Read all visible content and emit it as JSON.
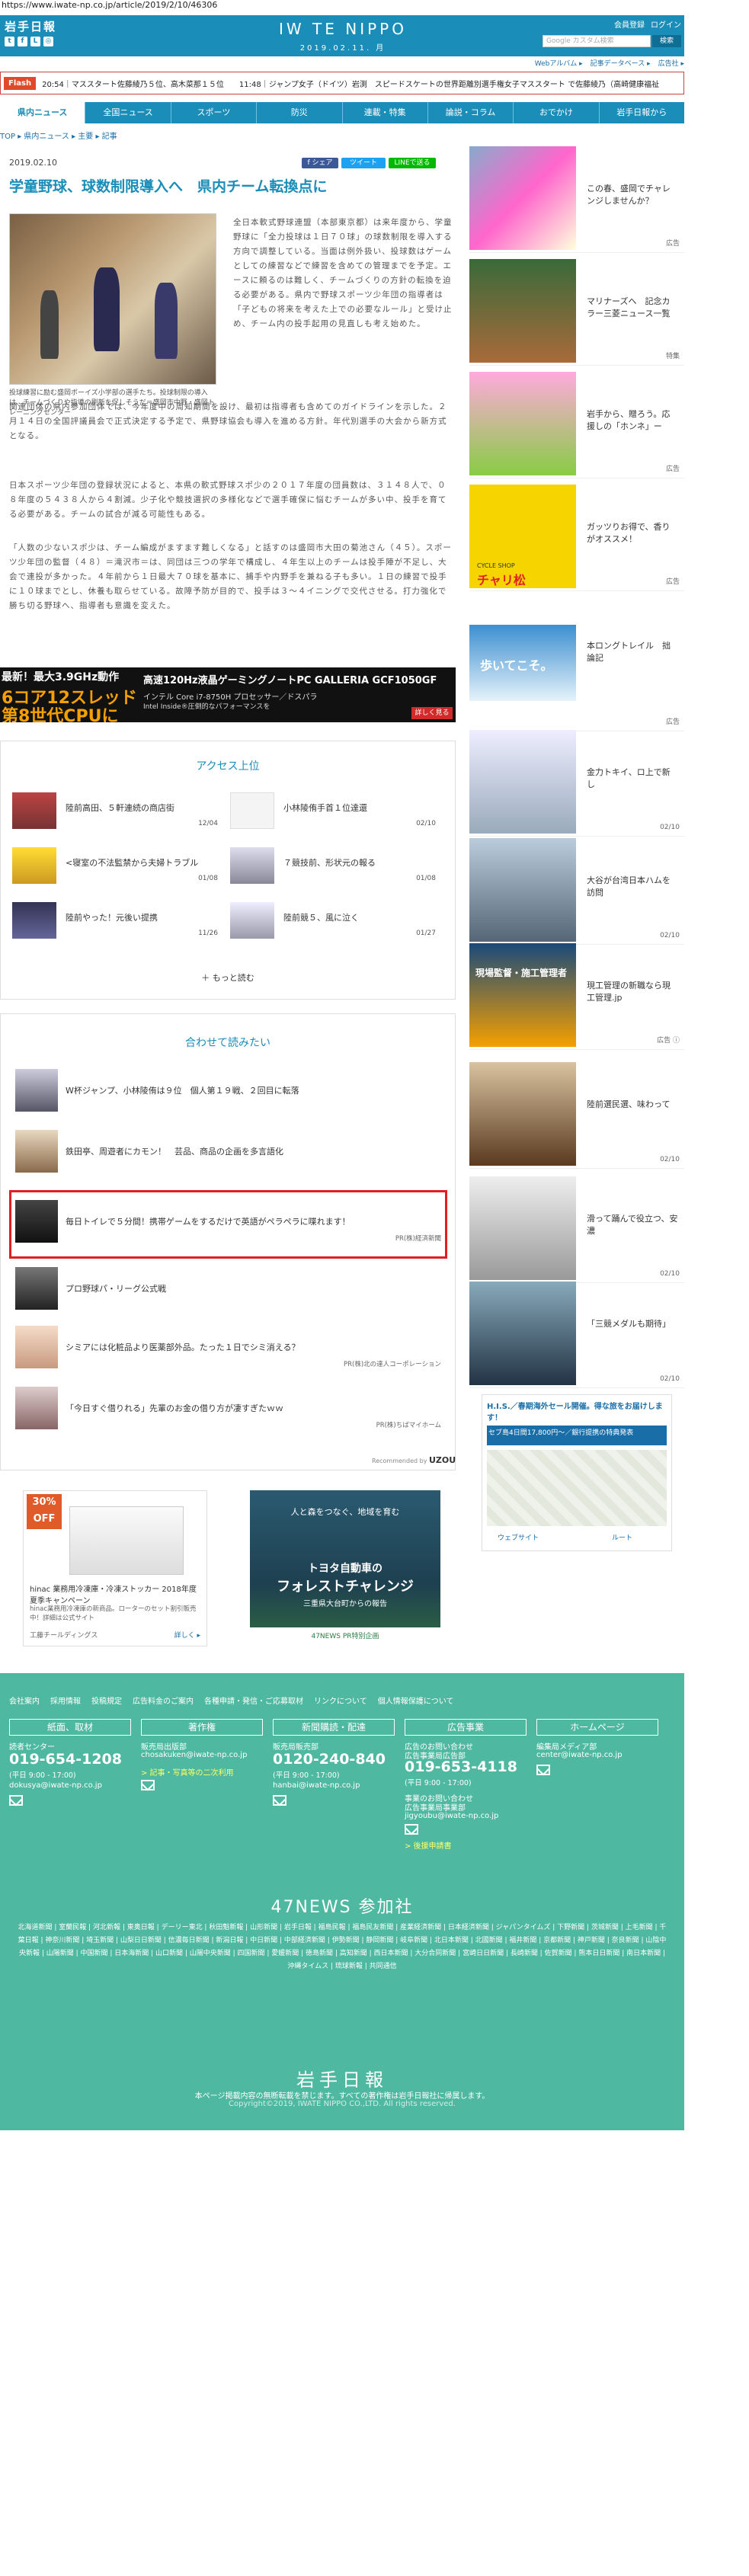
{
  "url": "https://www.iwate-np.co.jp/article/2019/2/10/46306",
  "header": {
    "logo_left": "岩手日報",
    "center_logo": "IW TE NIPPO",
    "center_date": "2019.02.11. 月",
    "login": [
      "会員登録",
      "ログイン"
    ],
    "search_placeholder": "Google カスタム検索",
    "search_button": "検索",
    "sublinks": [
      "Webアルバム ▸",
      "記事データベース ▸",
      "広告社 ▸"
    ]
  },
  "flash": {
    "label": "Flash",
    "text": "20:54｜マススタート佐藤綾乃５位、高木菜那１５位　　11:48｜ジャンプ女子（ドイツ）岩渕　スピードスケートの世界距離別選手権女子マススタート で佐藤綾乃（高崎健康福祉"
  },
  "nav": [
    "県内ニュース",
    "全国ニュース",
    "スポーツ",
    "防災",
    "連載・特集",
    "論説・コラム",
    "おでかけ",
    "岩手日報から"
  ],
  "breadcrumb": "TOP ▸ 県内ニュース ▸ 主要 ▸ 記事",
  "article": {
    "date": "2019.02.10",
    "share": [
      "f シェア",
      "ツイート",
      "LINEで送る"
    ],
    "title": "学童野球、球数制限導入へ　県内チーム転換点に",
    "caption": "投球練習に励む盛岡ボーイズ小学部の選手たち。投球制限の導入は、チームづくりや指導の刷新を促しそうだ＝盛岡市中野・盛岡トレーニングセンター",
    "lead": "全日本軟式野球連盟（本部東京都）は来年度から、学童野球に「全力投球は１日７０球」の球数制限を導入する方向で調整している。当面は例外扱い、投球数はゲームとしての練習などで練習を含めての管理までを予定。エースに頼るのは難しく、チームづくりの方針の転換を迫る必要がある。県内で野球スポーツ少年団の指導者は「子どもの将来を考えた上での必要なルール」と受け止め、チーム内の投手起用の見直しも考え始めた。",
    "p1": "関連団体の県内参加団体では、今年度中の周知期間を設け、最初は指導者も含めてのガイドラインを示した。２月１４日の全国評議員会で正式決定する予定で、県野球協会も導入を進める方針。年代別選手の大会から新方式となる。",
    "p2": "日本スポーツ少年団の登録状況によると、本県の軟式野球スポ少の２０１７年度の団員数は、３１４８人で、０８年度の５４３８人から４割減。少子化や競技選択の多様化などで選手確保に悩むチームが多い中、投手を育てる必要がある。チームの試合が減る可能性もある。",
    "p3": "「人数の少ないスポ少は、チーム編成がますます難しくなる」と話すのは盛岡市大田の菊池さん（４５）。スポーツ少年団の監督（４８）＝滝沢市＝は、同団は三つの学年で構成し、４年生以上のチームは投手陣が不足し、大会で連投が多かった。４年前から１日最大７０球を基本に、捕手や内野手を兼ねる子も多い。１日の練習で投手に１０球までとし、休養も取らせている。故障予防が目的で、投手は３～４イニングで交代させる。打力強化で勝ち切る野球へ、指導者も意識を変えた。"
  },
  "pc_banner": {
    "l1": "最新！最大3.9GHz動作",
    "l2": "6コア12スレッド",
    "l3": "第8世代CPUに",
    "t1": "高速120Hz液晶ゲーミングノートPC GALLERIA GCF1050GF",
    "t2": "インテル Core i7-8750H プロセッサー／ドスパラ",
    "t3": "Intel Inside®圧倒的なパフォーマンスを",
    "btn": "詳しく見る"
  },
  "access": {
    "title": "アクセス上位",
    "items": [
      {
        "text": "陸前高田、５軒連続の商店街",
        "date": "12/04"
      },
      {
        "text": "小林陵侑手首１位達還",
        "date": "02/10"
      },
      {
        "text": "<寝室の不法監禁から夫婦トラブル",
        "date": "01/08"
      },
      {
        "text": "７競技前、形状元の報る",
        "date": "01/08"
      },
      {
        "text": "陸前やった！元後い提携",
        "date": "11/26"
      },
      {
        "text": "陸前競５、風に泣く",
        "date": "01/27"
      }
    ],
    "more": "＋ もっと読む"
  },
  "related": {
    "title": "合わせて読みたい",
    "items": [
      {
        "text": "W杯ジャンプ、小林陵侑は９位　個人第１９戦、２回目に転落",
        "pr": ""
      },
      {
        "text": "鉄田亭、周遊者にカモン！　芸品、商品の企画を多言語化",
        "pr": ""
      },
      {
        "text": "毎日トイレで５分間！携帯ゲームをするだけで英語がペラペラに喋れます！",
        "pr": "PR(株)経済新聞"
      },
      {
        "text": "プロ野球パ・リーグ公式戦",
        "pr": ""
      },
      {
        "text": "シミアには化粧品より医薬部外品。たった１日でシミ消える？",
        "pr": "PR(株)北の達人コーポレーション"
      },
      {
        "text": "「今日すぐ借りれる」先輩のお金の借り方が凄すぎたｗｗ",
        "pr": "PR(株)ちばマイホーム"
      }
    ],
    "credit": "Recommended by ",
    "credit_brand": "UZOU"
  },
  "ad1": {
    "badge": "30% OFF",
    "title": "hinac 業務用冷凍庫・冷凍ストッカー 2018年度夏季キャンペーン",
    "text": "hinac業務用冷凍庫の新商品。ローターのセット割引販売中！詳細は公式サイト",
    "brand": "工藤チールディングス",
    "more": "詳しく ▸"
  },
  "ad2": {
    "l1": "人と森をつなぐ、地域を育む",
    "l2": "トヨタ自動車の",
    "l3": "フォレストチャレンジ",
    "l4": "三重県大台町からの報告",
    "tag": "47NEWS PR特別企画"
  },
  "sidebar": [
    {
      "text": "この春、盛岡でチャレンジしませんか？",
      "foot": "広告"
    },
    {
      "text": "マリナーズへ　記念カラー三菱ニュース一覧",
      "foot": "特集"
    },
    {
      "text": "岩手から、贈ろう。応援しの「ホンネ」ー",
      "foot": "広告"
    },
    {
      "text": "ガッツりお得で、香りがオススメ！",
      "foot": "広告"
    },
    {
      "text": "本ロングトレイル　拙論記",
      "foot": "広告"
    },
    {
      "text": "金力トキイ、ロ上で新し",
      "foot": "02/10"
    },
    {
      "text": "大谷が台湾日本ハムを訪問",
      "foot": "02/10"
    },
    {
      "text": "現工管理の新職なら現工管理.jp",
      "foot": "広告 ⓘ"
    },
    {
      "text": "陸前選民選、味わって",
      "foot": "02/10"
    },
    {
      "text": "滑って踊んで役立つ、安濃",
      "foot": "02/10"
    },
    {
      "text": "「三競メダルも期待」",
      "foot": "02/10"
    }
  ],
  "side_ad_text": {
    "mascot": "チャリ松",
    "cycle": "CYCLE SHOP",
    "kansai": "現場監督・施工管理者",
    "trail": "歩いてこそ。"
  },
  "map_ad": {
    "title": "H.I.S.／春期海外セール開催。得な旅をお届けします！",
    "desc": "セブ島4日間17,800円〜／銀行提携の特典発表",
    "route": "ルート",
    "website": "ウェブサイト"
  },
  "footer": {
    "links": [
      "会社案内",
      "採用情報",
      "投稿規定",
      "広告料金のご案内",
      "各種申請・発信・ご応募取材",
      "リンクについて",
      "個人情報保護について"
    ],
    "cols": [
      {
        "title": "紙面、取材",
        "sub": "読者センター",
        "phone": "019-654-1208",
        "time": "(平日 9:00 - 17:00)",
        "email": "dokusya@iwate-np.co.jp"
      },
      {
        "title": "著作権",
        "sub": "販売局出版部",
        "phone": "",
        "time": "",
        "email": "chosakuken@iwate-np.co.jp",
        "extra": "> 記事・写真等の二次利用"
      },
      {
        "title": "新聞購読・配達",
        "sub": "販売局販売部",
        "phone": "0120-240-840",
        "time": "(平日 9:00 - 17:00)",
        "email": "hanbai@iwate-np.co.jp"
      },
      {
        "title": "広告事業",
        "sub": "広告のお問い合わせ",
        "sub2": "広告事業局広告部",
        "phone": "019-653-4118",
        "time": "(平日 9:00 - 17:00)",
        "email": "jigyoubu@iwate-np.co.jp",
        "extra": "> 後援申請書"
      },
      {
        "title": "ホームページ",
        "sub": "編集局メディア部",
        "phone": "",
        "time": "",
        "email": "center@iwate-np.co.jp"
      }
    ],
    "sub_event": "事業のお問い合わせ",
    "sub_event2": "広告事業局事業部",
    "news47_title": "47NEWS 参加社",
    "news47": "北海道新聞 | 室蘭民報 | 河北新報 | 東奥日報 | デーリー東北 | 秋田魁新報 | 山形新聞 | 岩手日報 | 福島民報 | 福島民友新聞 | 産業経済新聞 | 日本経済新聞 | ジャパンタイムズ | 下野新聞 | 茨城新聞 | 上毛新聞 | 千葉日報 | 神奈川新聞 | 埼玉新聞 | 山梨日日新聞 | 信濃毎日新聞 | 新潟日報 | 中日新聞 | 中部経済新聞 | 伊勢新聞 | 静岡新聞 | 岐阜新聞 | 北日本新聞 | 北國新聞 | 福井新聞 | 京都新聞 | 神戸新聞 | 奈良新聞 | 山陰中央新報 | 山陽新聞 | 中国新聞 | 日本海新聞 | 山口新聞 | 山陽中央新聞 | 四国新聞 | 愛媛新聞 | 徳島新聞 | 高知新聞 | 西日本新聞 | 大分合同新聞 | 宮崎日日新聞 | 長崎新聞 | 佐賀新聞 | 熊本日日新聞 | 南日本新聞 | 沖縄タイムス | 琉球新報 | 共同通信",
    "logo": "岩手日報",
    "notice": "本ページ掲載内容の無断転載を禁じます。すべての著作権は岩手日報社に帰属します。",
    "copyright": "Copyright©2019, IWATE NIPPO CO.,LTD. All rights reserved."
  }
}
